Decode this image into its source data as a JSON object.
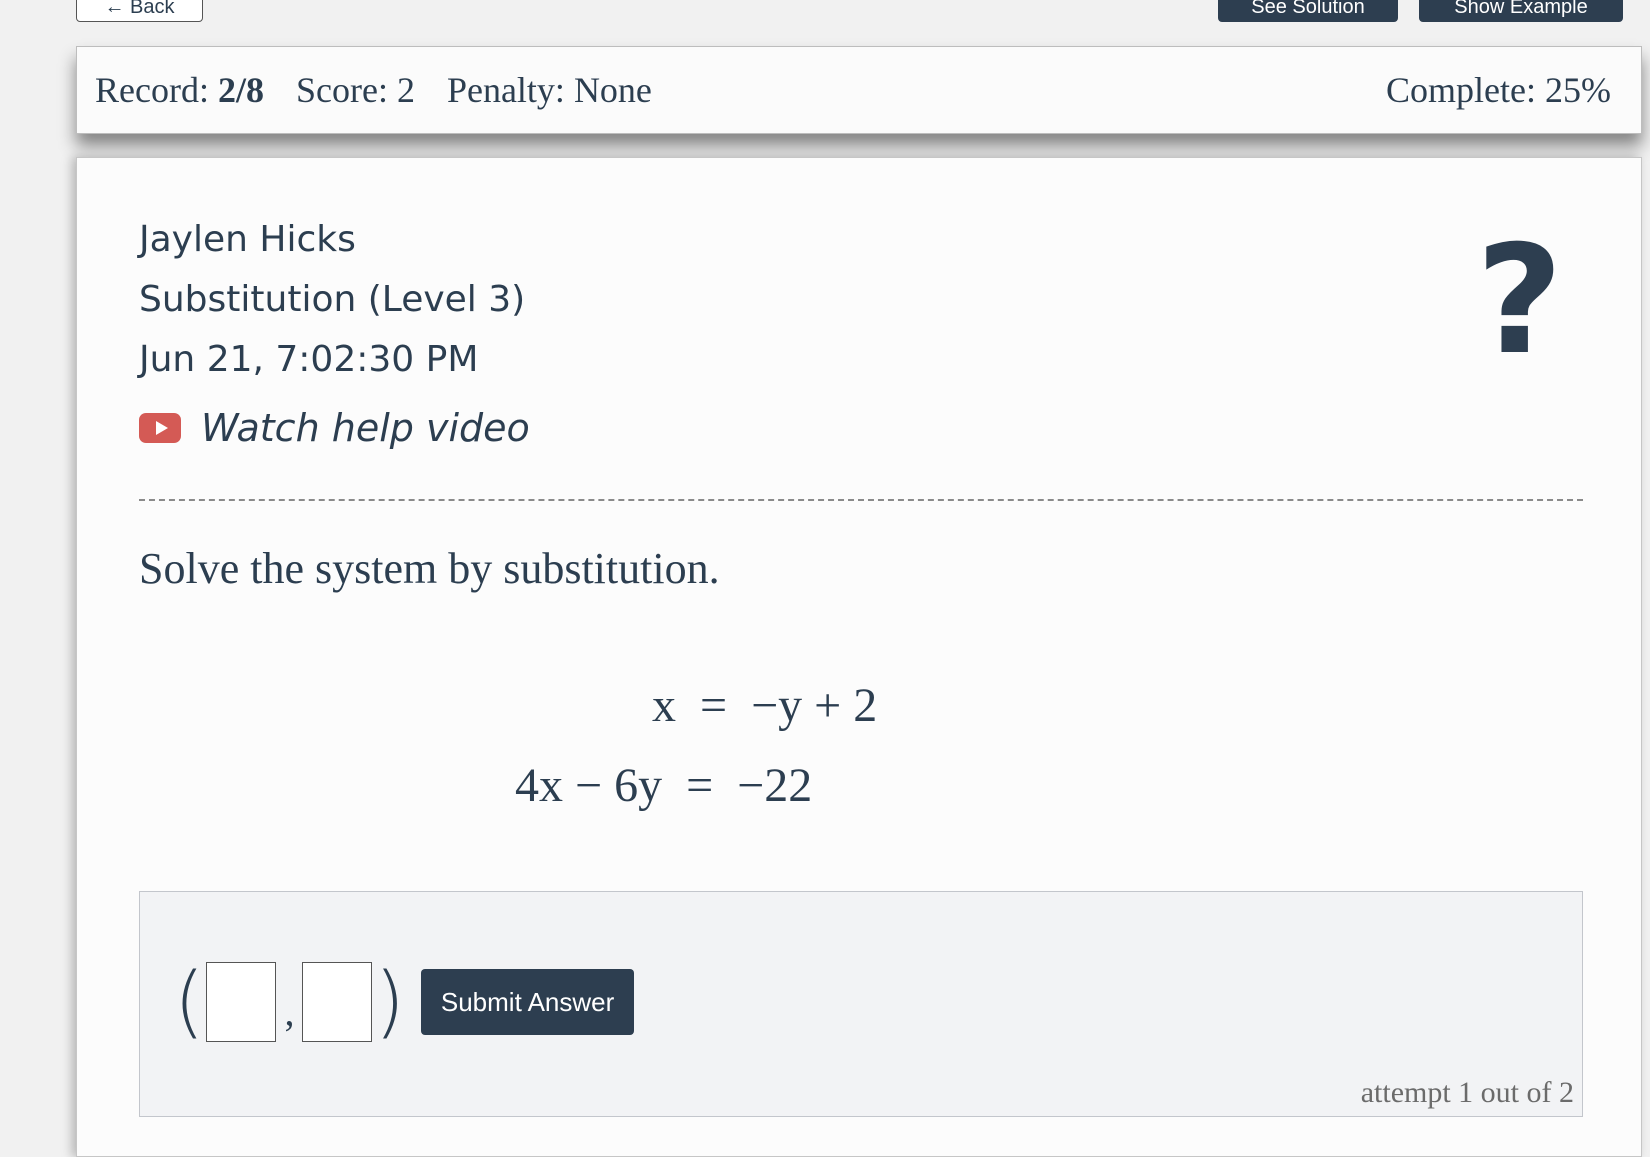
{
  "top_buttons": {
    "back": "← Back",
    "solution": "See Solution",
    "example": "Show Example"
  },
  "stats": {
    "record_label": "Record:",
    "record_value": "2/8",
    "score": "Score: 2",
    "penalty": "Penalty: None",
    "complete": "Complete: 25%"
  },
  "info": {
    "student": "Jaylen Hicks",
    "topic": "Substitution (Level 3)",
    "timestamp": "Jun 21, 7:02:30 PM",
    "video_label": "Watch help video",
    "help_symbol": "?"
  },
  "problem": {
    "prompt": "Solve the system by substitution.",
    "equation1": "x  =  −y + 2",
    "equation2": "4x − 6y  =  −22"
  },
  "answer": {
    "open_paren": "(",
    "comma": ",",
    "close_paren": ")",
    "submit_label": "Submit Answer",
    "attempt_text": "attempt 1 out of 2"
  },
  "colors": {
    "primary": "#2d3e50",
    "video_red": "#d45a55"
  }
}
